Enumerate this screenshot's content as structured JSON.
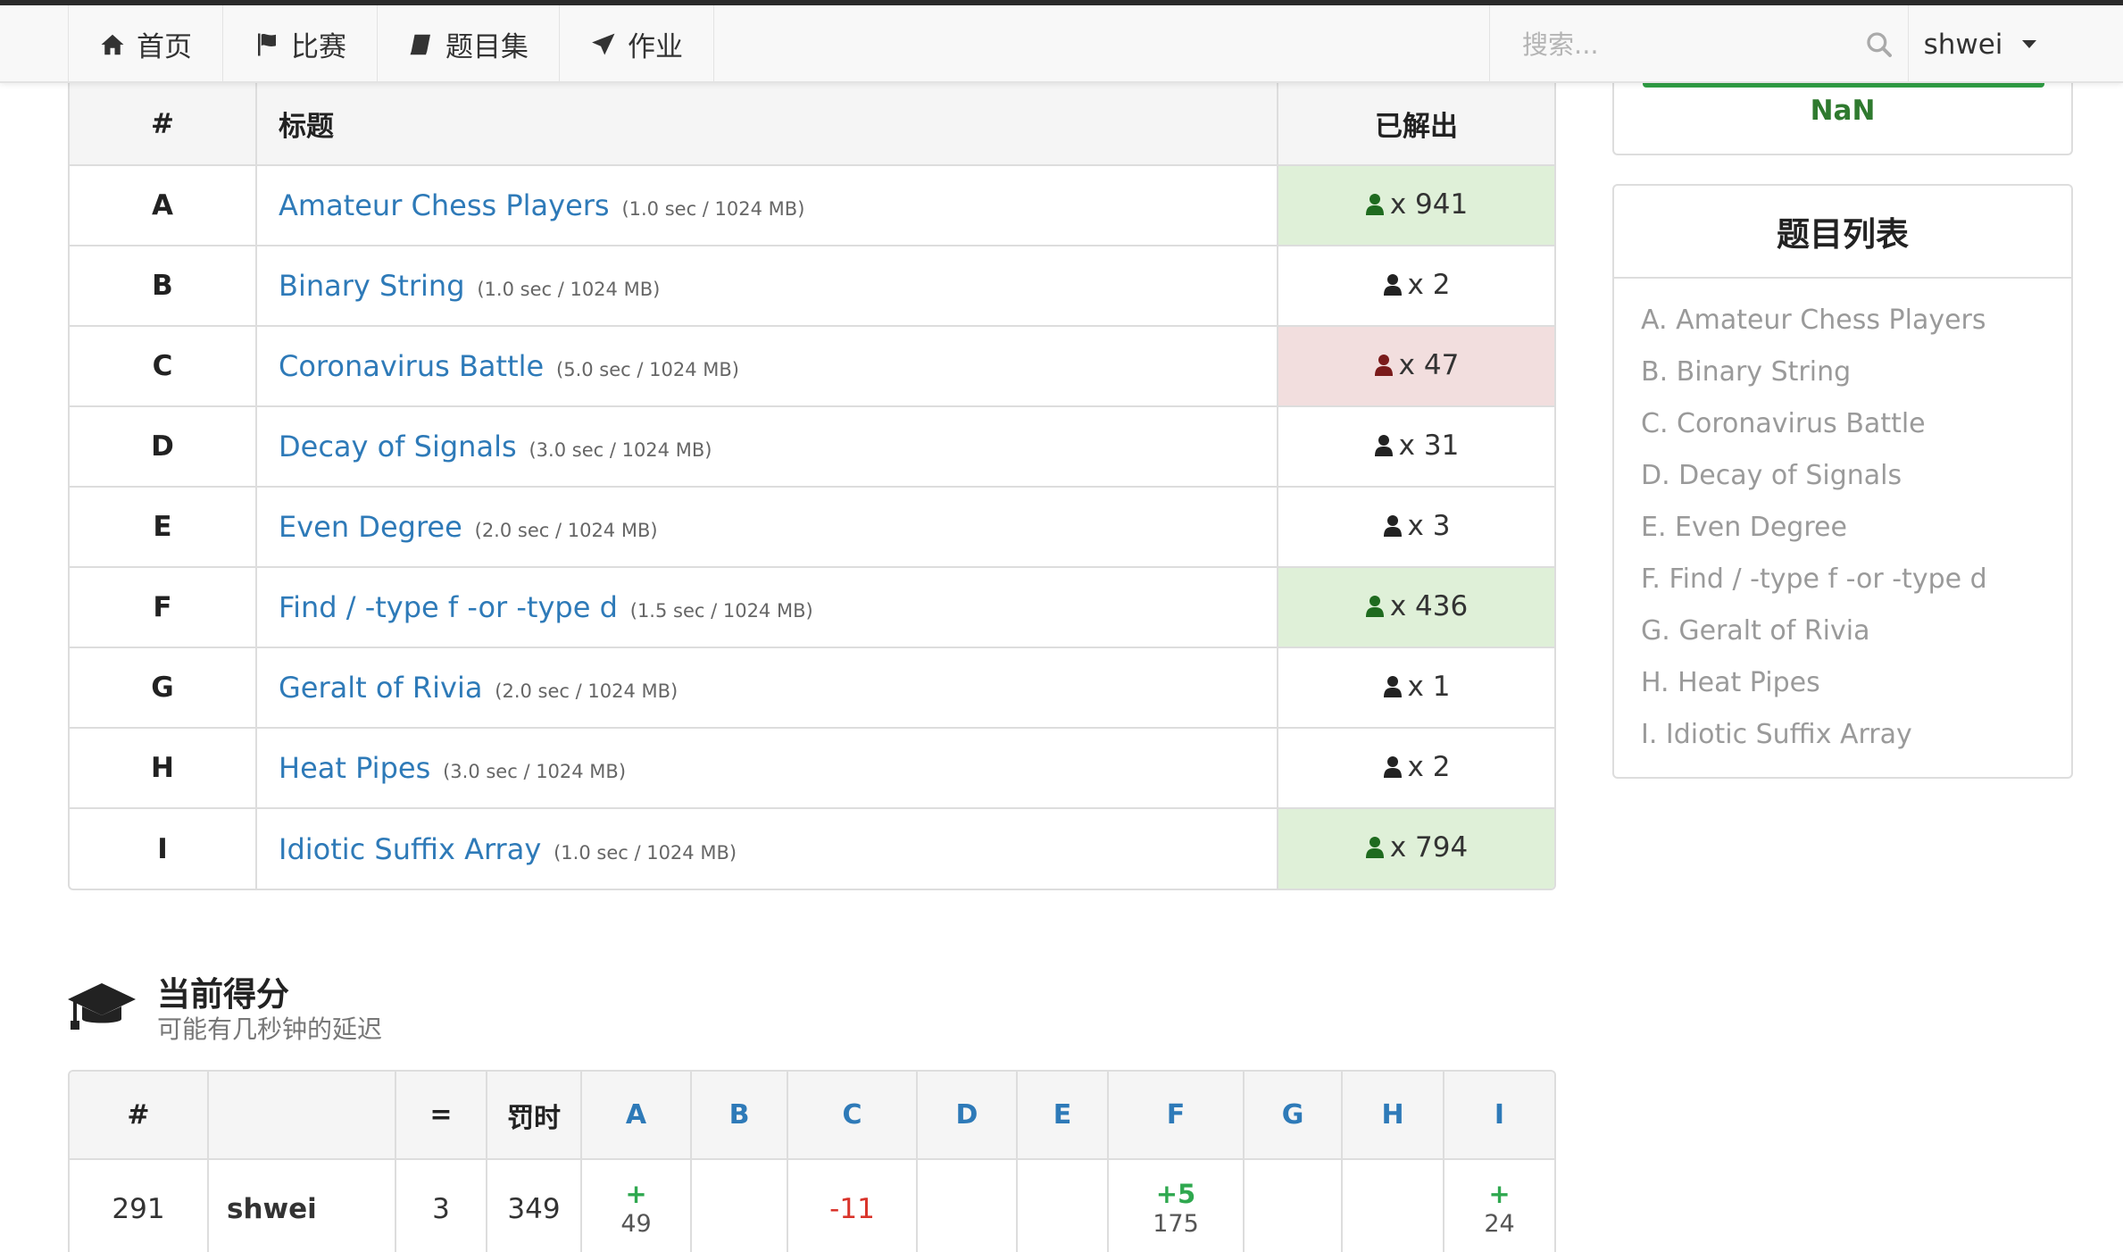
{
  "nav": {
    "items": [
      {
        "label": "首页",
        "icon": "home-icon"
      },
      {
        "label": "比赛",
        "icon": "flag-icon"
      },
      {
        "label": "题目集",
        "icon": "book-icon"
      },
      {
        "label": "作业",
        "icon": "plane-icon"
      }
    ],
    "search_placeholder": "搜索...",
    "user": "shwei"
  },
  "problems": {
    "headers": {
      "id": "#",
      "title": "标题",
      "solved": "已解出"
    },
    "rows": [
      {
        "id": "A",
        "title": "Amateur Chess Players",
        "limit": "(1.0 sec / 1024 MB)",
        "solved": "x 941",
        "status": "ac"
      },
      {
        "id": "B",
        "title": "Binary String",
        "limit": "(1.0 sec / 1024 MB)",
        "solved": "x 2",
        "status": "none"
      },
      {
        "id": "C",
        "title": "Coronavirus Battle",
        "limit": "(5.0 sec / 1024 MB)",
        "solved": "x 47",
        "status": "wa"
      },
      {
        "id": "D",
        "title": "Decay of Signals",
        "limit": "(3.0 sec / 1024 MB)",
        "solved": "x 31",
        "status": "none"
      },
      {
        "id": "E",
        "title": "Even Degree",
        "limit": "(2.0 sec / 1024 MB)",
        "solved": "x 3",
        "status": "none"
      },
      {
        "id": "F",
        "title": "Find / -type f -or -type d",
        "limit": "(1.5 sec / 1024 MB)",
        "solved": "x 436",
        "status": "ac"
      },
      {
        "id": "G",
        "title": "Geralt of Rivia",
        "limit": "(2.0 sec / 1024 MB)",
        "solved": "x 1",
        "status": "none"
      },
      {
        "id": "H",
        "title": "Heat Pipes",
        "limit": "(3.0 sec / 1024 MB)",
        "solved": "x 2",
        "status": "none"
      },
      {
        "id": "I",
        "title": "Idiotic Suffix Array",
        "limit": "(1.0 sec / 1024 MB)",
        "solved": "x 794",
        "status": "ac"
      }
    ]
  },
  "side": {
    "nan": "NaN",
    "list_title": "题目列表",
    "list": [
      "A. Amateur Chess Players",
      "B. Binary String",
      "C. Coronavirus Battle",
      "D. Decay of Signals",
      "E. Even Degree",
      "F. Find / -type f -or -type d",
      "G. Geralt of Rivia",
      "H. Heat Pipes",
      "I. Idiotic Suffix Array"
    ]
  },
  "score": {
    "title": "当前得分",
    "subtitle": "可能有几秒钟的延迟",
    "headers": [
      "#",
      "",
      "=",
      "罚时",
      "A",
      "B",
      "C",
      "D",
      "E",
      "F",
      "G",
      "H",
      "I"
    ],
    "row": {
      "rank": "291",
      "user": "shwei",
      "solved": "3",
      "penalty": "349",
      "cells": [
        {
          "kind": "ac",
          "tries": "+",
          "time": "49"
        },
        {
          "kind": "empty"
        },
        {
          "kind": "wa",
          "text": "-11"
        },
        {
          "kind": "empty"
        },
        {
          "kind": "empty"
        },
        {
          "kind": "ac",
          "tries": "+5",
          "time": "175"
        },
        {
          "kind": "empty"
        },
        {
          "kind": "empty"
        },
        {
          "kind": "ac",
          "tries": "+",
          "time": "24"
        }
      ]
    }
  },
  "colors": {
    "link": "#2e7ab8",
    "ac_bg": "#dff0d8",
    "wa_bg": "#f2dede",
    "ac_icon": "#1f6b1f",
    "wa_icon": "#7a1b1b",
    "neutral_icon": "#222222",
    "wa_text": "#d9342b",
    "ac_text": "#2fa84f"
  }
}
